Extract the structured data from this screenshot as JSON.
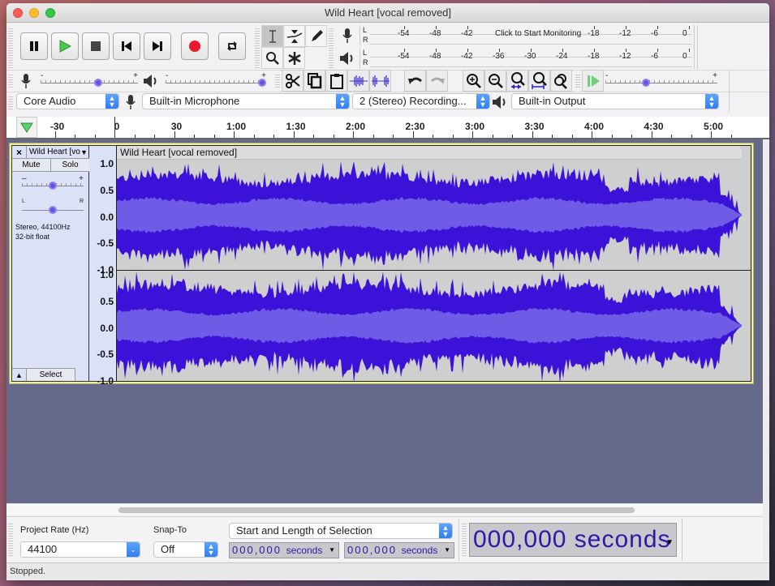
{
  "window": {
    "title": "Wild Heart [vocal removed]"
  },
  "transport": {
    "buttons": [
      {
        "name": "pause-button",
        "icon": "pause-icon",
        "label": "Pause"
      },
      {
        "name": "play-button",
        "icon": "play-icon",
        "label": "Play"
      },
      {
        "name": "stop-button",
        "icon": "stop-icon",
        "label": "Stop"
      },
      {
        "name": "skip-start-button",
        "icon": "skip-start-icon",
        "label": "Skip to Start"
      },
      {
        "name": "skip-end-button",
        "icon": "skip-end-icon",
        "label": "Skip to End"
      },
      {
        "name": "record-button",
        "icon": "record-icon",
        "label": "Record"
      },
      {
        "name": "loop-button",
        "icon": "loop-icon",
        "label": "Loop"
      }
    ]
  },
  "tools": {
    "selection": "Selection Tool",
    "envelope": "Envelope Tool",
    "draw": "Draw Tool",
    "zoom": "Zoom Tool",
    "multi": "Multi-Tool"
  },
  "meters": {
    "record_scale": [
      "-54",
      "-48",
      "-42",
      "-18",
      "-12",
      "-6",
      "0"
    ],
    "record_prompt": "Click to Start Monitoring",
    "playback_scale": [
      "-54",
      "-48",
      "-42",
      "-36",
      "-30",
      "-24",
      "-18",
      "-12",
      "-6",
      "0"
    ],
    "channels": [
      "L",
      "R"
    ]
  },
  "mixer": {
    "recording_volume": 0.6,
    "playback_volume": 1.0,
    "minus": "-",
    "plus": "+"
  },
  "play_at_speed": {
    "value": 0.35
  },
  "devices": {
    "host": "Core Audio",
    "input": "Built-in Microphone",
    "channels": "2 (Stereo) Recording...",
    "output": "Built-in Output"
  },
  "timeline": {
    "labels": [
      "-30",
      "0",
      "30",
      "1:00",
      "1:30",
      "2:00",
      "2:30",
      "3:00",
      "3:30",
      "4:00",
      "4:30",
      "5:00"
    ]
  },
  "track": {
    "name": "Wild Heart [vo",
    "clip_name": "Wild Heart [vocal removed]",
    "mute": "Mute",
    "solo": "Solo",
    "gain": 0.5,
    "pan": 0.5,
    "gain_minus": "–",
    "gain_plus": "+",
    "pan_left": "L",
    "pan_right": "R",
    "info_line1": "Stereo, 44100Hz",
    "info_line2": "32-bit float",
    "select": "Select",
    "close": "×",
    "collapse": "▲",
    "vruler_labels": [
      "1.0",
      "0.5",
      "0.0",
      "-0.5",
      "-1.0"
    ],
    "colors": {
      "wave": "#3c12d8",
      "rms": "#6e5ce6",
      "background": "#cfcfcf"
    }
  },
  "selection_toolbar": {
    "project_rate_label": "Project Rate (Hz)",
    "project_rate": "44100",
    "snap_label": "Snap-To",
    "snap": "Off",
    "selection_mode": "Start and Length of Selection",
    "start_digits": "000,000",
    "length_digits": "000,000",
    "unit": "seconds"
  },
  "audio_position": {
    "digits": "000,000",
    "unit": "seconds"
  },
  "status": {
    "text": "Stopped."
  }
}
